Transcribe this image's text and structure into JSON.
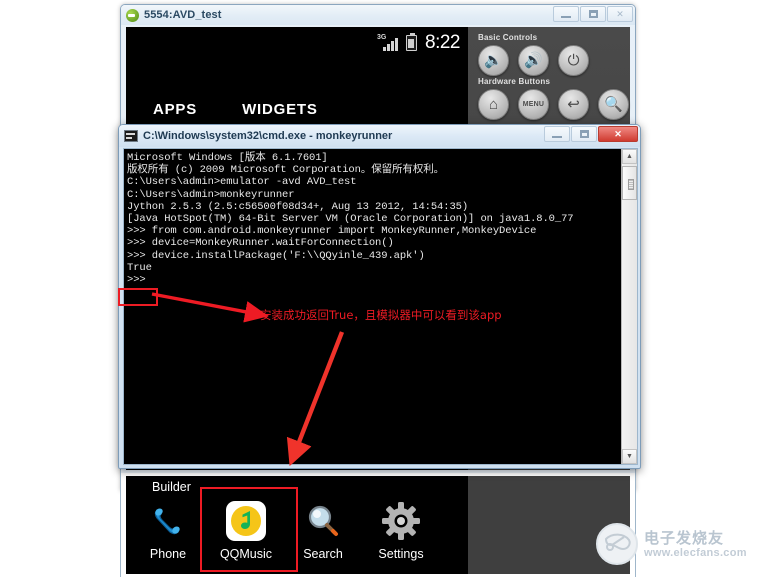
{
  "background_color": "#ffffff",
  "emulator_window": {
    "title": "5554:AVD_test",
    "title_icon": "android-emulator-icon",
    "window_buttons": {
      "minimize": "minimize-icon",
      "maximize": "maximize-icon",
      "close": "✕"
    },
    "status_bar": {
      "network_label": "3G",
      "signal_icon": "signal-bars-icon",
      "battery_icon": "battery-icon",
      "clock": "8:22"
    },
    "drawer": {
      "tab_apps": "APPS",
      "tab_widgets": "WIDGETS",
      "active_tab": "APPS"
    },
    "controls": {
      "basic_label": "Basic Controls",
      "hardware_label": "Hardware Buttons",
      "buttons": [
        {
          "name": "volume-down-button",
          "glyph": "🔈"
        },
        {
          "name": "volume-up-button",
          "glyph": "🔊"
        },
        {
          "name": "power-button",
          "glyph": "⏻"
        },
        {
          "name": "home-button",
          "glyph": "⌂"
        },
        {
          "name": "menu-button",
          "glyph": "MENU"
        },
        {
          "name": "back-button",
          "glyph": "↩"
        },
        {
          "name": "search-button",
          "glyph": "🔍"
        }
      ]
    }
  },
  "cmd_window": {
    "title": "C:\\Windows\\system32\\cmd.exe - monkeyrunner",
    "title_icon": "console-icon",
    "window_buttons": {
      "minimize": "minimize-icon",
      "maximize": "maximize-icon",
      "close": "✕"
    },
    "console_lines": [
      "Microsoft Windows [版本 6.1.7601]",
      "版权所有 (c) 2009 Microsoft Corporation。保留所有权利。",
      "",
      "C:\\Users\\admin>emulator -avd AVD_test",
      "",
      "C:\\Users\\admin>monkeyrunner",
      "Jython 2.5.3 (2.5:c56500f08d34+, Aug 13 2012, 14:54:35)",
      "[Java HotSpot(TM) 64-Bit Server VM (Oracle Corporation)] on java1.8.0_77",
      ">>> from com.android.monkeyrunner import MonkeyRunner,MonkeyDevice",
      ">>> device=MonkeyRunner.waitForConnection()",
      ">>> device.installPackage('F:\\\\QQyinle_439.apk')",
      "True",
      ">>>"
    ],
    "scrollbar": {
      "up_arrow": "▲",
      "down_arrow": "▼"
    }
  },
  "annotations": {
    "highlighted_value": "True",
    "note_text": "安装成功返回True，且模拟器中可以看到该app",
    "note_color": "#ee1b24",
    "box_color": "#ec1c24"
  },
  "app_drawer": {
    "partial_label": "Builder",
    "apps": [
      {
        "label": "Phone",
        "icon": "phone-icon"
      },
      {
        "label": "QQMusic",
        "icon": "qqmusic-icon"
      },
      {
        "label": "Search",
        "icon": "search-icon"
      },
      {
        "label": "Settings",
        "icon": "settings-gear-icon"
      }
    ],
    "highlighted_app": "QQMusic"
  },
  "watermark": {
    "brand_cn": "电子发烧友",
    "url": "www.elecfans.com"
  }
}
